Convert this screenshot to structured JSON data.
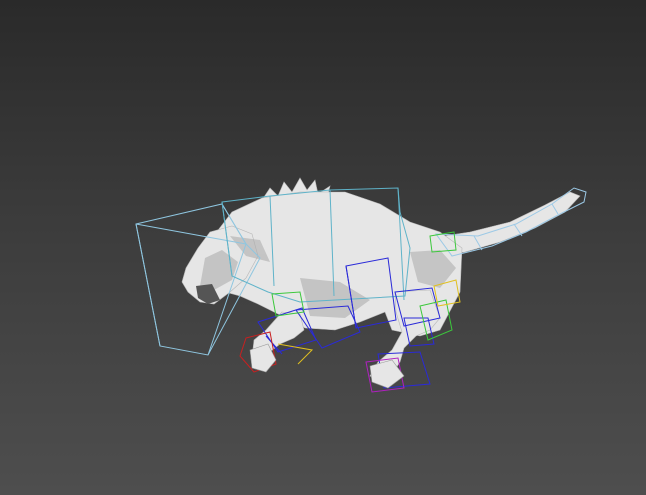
{
  "viewport": {
    "background_top": "#2a2a2a",
    "background_bottom": "#4e4e4e"
  },
  "model": {
    "mesh_color": "#e6e6e6",
    "mesh_shadow": "#a9a9a9"
  },
  "rig": {
    "head_box_color": "#8fc6e0",
    "spine_box_color": "#5fb3c9",
    "leg_box_color": "#2a2ad8",
    "tail_color": "#9cc9e6",
    "accent_colors": [
      "#3cc83c",
      "#e0c020",
      "#c82020",
      "#b020c0"
    ]
  }
}
